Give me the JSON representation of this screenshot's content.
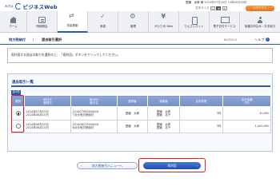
{
  "header": {
    "bank_small": "みずほ",
    "bank_name": "ビジネスWeb",
    "user_label": "愛媛　太郎 様",
    "last_login": "2014年07月20日 10時00分00秒",
    "text_size_label": "文字サイズ",
    "text_sizes": [
      "小",
      "中",
      "大"
    ],
    "logout_label": "ログアウト"
  },
  "nav": {
    "items": [
      {
        "label": "ホーム",
        "icon": "home-icon"
      },
      {
        "label": "明細照会",
        "icon": "document-icon"
      },
      {
        "label": "資金移動",
        "icon": "transfer-icon",
        "active": true
      },
      {
        "label": "承認",
        "icon": "check-icon"
      },
      {
        "label": "管理",
        "icon": "gear-icon"
      },
      {
        "label": "がいため Web",
        "icon": "yen-icon"
      },
      {
        "label": "でんさいネット",
        "icon": "phone-icon"
      },
      {
        "label": "電子交付サービス",
        "icon": "screen-icon"
      },
      {
        "label": "各種お申込み・お手続き",
        "icon": "person-icon"
      }
    ]
  },
  "titlebar": {
    "breadcrumb": "地方税納付",
    "title": "過去取引選択",
    "screen_id": "BKZN015",
    "help_label": "ヘルプ"
  },
  "instruction": "再利用する過去の取引を選択の上、「再利用」ボタンをクリックしてください。",
  "history": {
    "title": "過去取引一覧",
    "total_label": "全2件",
    "columns": [
      "選択",
      "納付日\n登録日",
      "取引ID\n取引名",
      "登録者",
      "承認者",
      "合計件数",
      "合計金額\n(円)"
    ],
    "rows": [
      {
        "selected": true,
        "dates": [
          "2014年07月15日",
          "2014年06月10日"
        ],
        "trans": [
          "201407090000001",
          "7月分地方税納付"
        ],
        "registrant": "愛媛　太郎",
        "approver": [
          "愛媛　太郎",
          "愛媛　花子"
        ],
        "count": "3件",
        "amount": "40,000"
      },
      {
        "selected": false,
        "dates": [
          "2014年06月10日",
          "2014年06月15日"
        ],
        "trans": [
          "201406270000001",
          "6月分地方税納付"
        ],
        "registrant": "愛媛　太郎",
        "approver": [
          "愛媛　太郎",
          "愛媛　花子"
        ],
        "count": "3件",
        "amount": "1,000,000"
      }
    ]
  },
  "buttons": {
    "back_label": "地方税納付メニューへ",
    "reuse_label": "再利用"
  },
  "colors": {
    "accent": "#2a5ab8",
    "highlight": "#e02020",
    "logout": "#e5741a"
  }
}
